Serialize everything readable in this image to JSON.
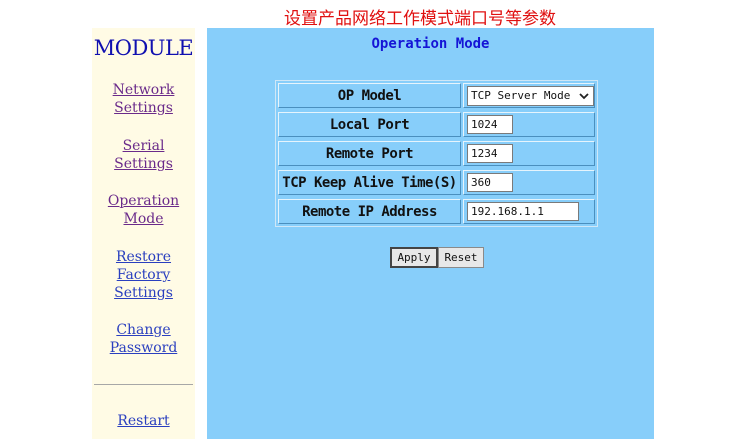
{
  "banner": "设置产品网络工作模式端口号等参数",
  "sidebar": {
    "brand": "MODULE",
    "items": [
      {
        "label": "Network\nSettings"
      },
      {
        "label": "Serial\nSettings"
      },
      {
        "label": "Operation\nMode"
      },
      {
        "label": "Restore\nFactory\nSettings"
      },
      {
        "label": "Change\nPassword"
      },
      {
        "label": "Restart"
      }
    ]
  },
  "main": {
    "title": "Operation Mode",
    "rows": [
      {
        "label": "OP Model",
        "value": "TCP Server Mode"
      },
      {
        "label": "Local Port",
        "value": "1024"
      },
      {
        "label": "Remote Port",
        "value": "1234"
      },
      {
        "label": "TCP Keep Alive Time(S)",
        "value": "360"
      },
      {
        "label": "Remote IP Address",
        "value": "192.168.1.1"
      }
    ],
    "apply_label": "Apply",
    "reset_label": "Reset"
  },
  "colors": {
    "banner": "#e01010",
    "sidebar_bg": "#fffbe5",
    "main_bg": "#87cefa",
    "title": "#1515d6",
    "link_visited": "#6a2a8a",
    "link": "#2a3fbf"
  },
  "icons": {
    "dropdown": "chevron-down-icon"
  }
}
